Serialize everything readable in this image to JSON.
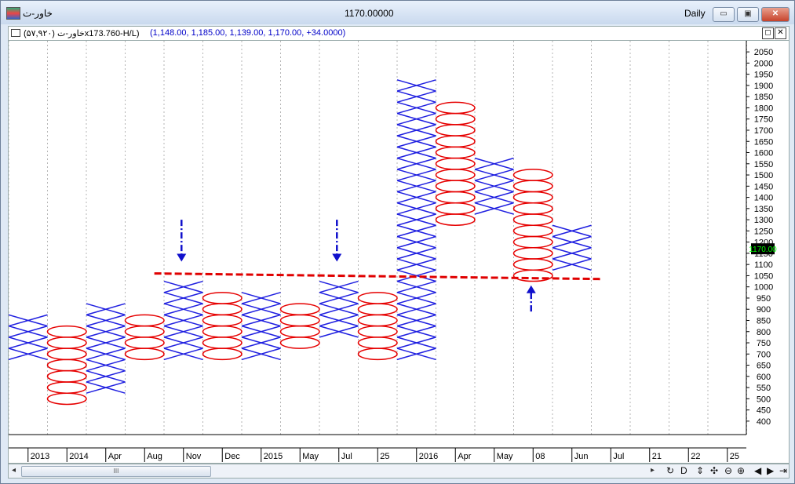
{
  "window": {
    "symbol_title": "خاور-ت",
    "center_value": "1170.00000",
    "period": "Daily",
    "minimize_label": "▭",
    "restore_label": "▣",
    "close_label": "✕"
  },
  "infobar": {
    "symbol": "خاور-ت (۵۷,۹۲۰)",
    "box_reversal": "x173.760-H/L)",
    "values": "(1,148.00, 1,185.00, 1,139.00, 1,170.00, +34.0000)",
    "restore_label": "◻",
    "close_label": "✕"
  },
  "chart_data": {
    "type": "point-and-figure",
    "box_size": 50,
    "ylim": [
      375,
      2075
    ],
    "y_ticks": [
      400,
      450,
      500,
      550,
      600,
      650,
      700,
      750,
      800,
      850,
      900,
      950,
      1000,
      1050,
      1100,
      1150,
      1200,
      1250,
      1300,
      1350,
      1400,
      1450,
      1500,
      1550,
      1600,
      1650,
      1700,
      1750,
      1800,
      1850,
      1900,
      1950,
      2000,
      2050
    ],
    "last_price": "1170.00",
    "colors": {
      "x": "#1f1fe0",
      "o": "#e60000",
      "trendline": "#e00000",
      "arrow": "#1010cc",
      "last_price_bg": "#000000",
      "last_price_fg": "#00ff00"
    },
    "columns": [
      {
        "type": "X",
        "low": 700,
        "high": 850
      },
      {
        "type": "O",
        "low": 500,
        "high": 800
      },
      {
        "type": "X",
        "low": 550,
        "high": 900
      },
      {
        "type": "O",
        "low": 700,
        "high": 850
      },
      {
        "type": "X",
        "low": 700,
        "high": 1000
      },
      {
        "type": "O",
        "low": 700,
        "high": 950
      },
      {
        "type": "X",
        "low": 700,
        "high": 950
      },
      {
        "type": "O",
        "low": 750,
        "high": 900
      },
      {
        "type": "X",
        "low": 800,
        "high": 1000
      },
      {
        "type": "O",
        "low": 700,
        "high": 950
      },
      {
        "type": "X",
        "low": 700,
        "high": 1900
      },
      {
        "type": "O",
        "low": 1300,
        "high": 1800
      },
      {
        "type": "X",
        "low": 1350,
        "high": 1550
      },
      {
        "type": "O",
        "low": 1050,
        "high": 1500
      },
      {
        "type": "X",
        "low": 1100,
        "high": 1250
      }
    ],
    "support_line": {
      "x_start": 3.75,
      "y_start": 1060,
      "x_end": 15.25,
      "y_end": 1035
    },
    "arrows": [
      {
        "x": 4.45,
        "y_tail": 1300,
        "y_head": 1120,
        "direction": "down"
      },
      {
        "x": 8.45,
        "y_tail": 1300,
        "y_head": 1120,
        "direction": "down"
      },
      {
        "x": 13.45,
        "y_tail": 890,
        "y_head": 1000,
        "direction": "up"
      }
    ],
    "x_tick_labels": [
      "2013",
      "2014",
      "Apr",
      "Aug",
      "Nov",
      "Dec",
      "2015",
      "May",
      "Jul",
      "25",
      "2016",
      "Apr",
      "May",
      "08",
      "Jun",
      "Jul",
      "21",
      "22",
      "25"
    ]
  },
  "toolbar": {
    "scroll_grip": "III",
    "left_arrow": "◂",
    "right_arrow": "▸",
    "icons": [
      "↻",
      "D",
      "⇕",
      "✣",
      "⊖",
      "⊕",
      "◀",
      "▶",
      "⇥"
    ]
  }
}
